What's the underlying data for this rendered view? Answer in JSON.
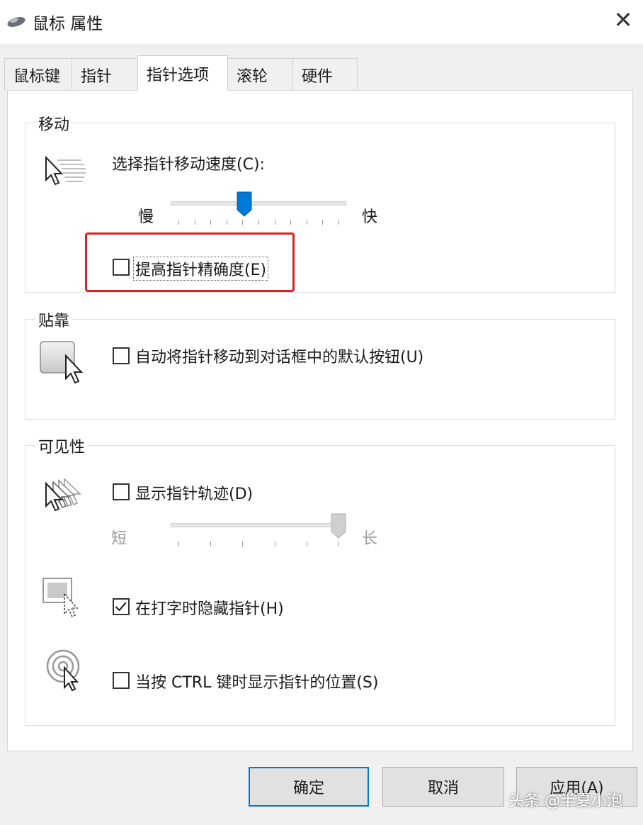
{
  "window": {
    "title": "鼠标 属性",
    "close_glyph": "✕"
  },
  "tabs": [
    {
      "label": "鼠标键"
    },
    {
      "label": "指针"
    },
    {
      "label": "指针选项"
    },
    {
      "label": "滚轮"
    },
    {
      "label": "硬件"
    }
  ],
  "active_tab": "指针选项",
  "motion": {
    "group_label": "移动",
    "speed_label": "选择指针移动速度(C):",
    "slow_label": "慢",
    "fast_label": "快",
    "speed_value": 0.41,
    "precision_label": "提高指针精确度(E)",
    "precision_checked": false
  },
  "snap_to": {
    "group_label": "贴靠",
    "snap_label": "自动将指针移动到对话框中的默认按钮(U)",
    "snap_checked": false
  },
  "visibility": {
    "group_label": "可见性",
    "trails_label": "显示指针轨迹(D)",
    "trails_checked": false,
    "short_label": "短",
    "long_label": "长",
    "trail_value": 1.0,
    "hide_label": "在打字时隐藏指针(H)",
    "hide_checked": true,
    "ctrl_label": "当按 CTRL 键时显示指针的位置(S)",
    "ctrl_checked": false
  },
  "buttons": {
    "ok": "确定",
    "cancel": "取消",
    "apply": "应用(A)"
  },
  "watermark": "头条 @半夏小泡",
  "colors": {
    "accent": "#0078d7",
    "highlight": "#e02020"
  }
}
